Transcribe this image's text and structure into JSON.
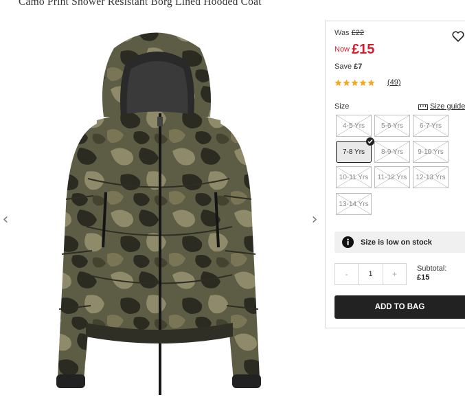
{
  "product": {
    "title": "Camo Print Shower Resistant Borg Lined Hooded Coat"
  },
  "price": {
    "was_label": "Was",
    "was_value": "£22",
    "now_label": "Now",
    "now_value": "£15",
    "save_label": "Save",
    "save_value": "£7"
  },
  "rating": {
    "stars": 5,
    "reviews": "(49)",
    "star_color": "#f5a623"
  },
  "size": {
    "label": "Size",
    "guide_label": "Size guide",
    "options": [
      {
        "label": "4-5 Yrs",
        "available": false
      },
      {
        "label": "5-6 Yrs",
        "available": false
      },
      {
        "label": "6-7 Yrs",
        "available": false
      },
      {
        "label": "7-8 Yrs",
        "available": true,
        "selected": true
      },
      {
        "label": "8-9 Yrs",
        "available": false
      },
      {
        "label": "9-10 Yrs",
        "available": false
      },
      {
        "label": "10-11 Yrs",
        "available": false
      },
      {
        "label": "11-12 Yrs",
        "available": false
      },
      {
        "label": "12-13 Yrs",
        "available": false
      },
      {
        "label": "13-14 Yrs",
        "available": false
      }
    ]
  },
  "stock": {
    "message": "Size is low on stock"
  },
  "quantity": {
    "minus": "-",
    "value": "1",
    "plus": "+"
  },
  "subtotal": {
    "label": "Subtotal:",
    "value": "£15"
  },
  "cart": {
    "add_label": "ADD TO BAG"
  },
  "nav": {
    "prev": "‹",
    "next": "›"
  },
  "colors": {
    "price_red": "#d11f2e",
    "button_dark": "#222222"
  }
}
